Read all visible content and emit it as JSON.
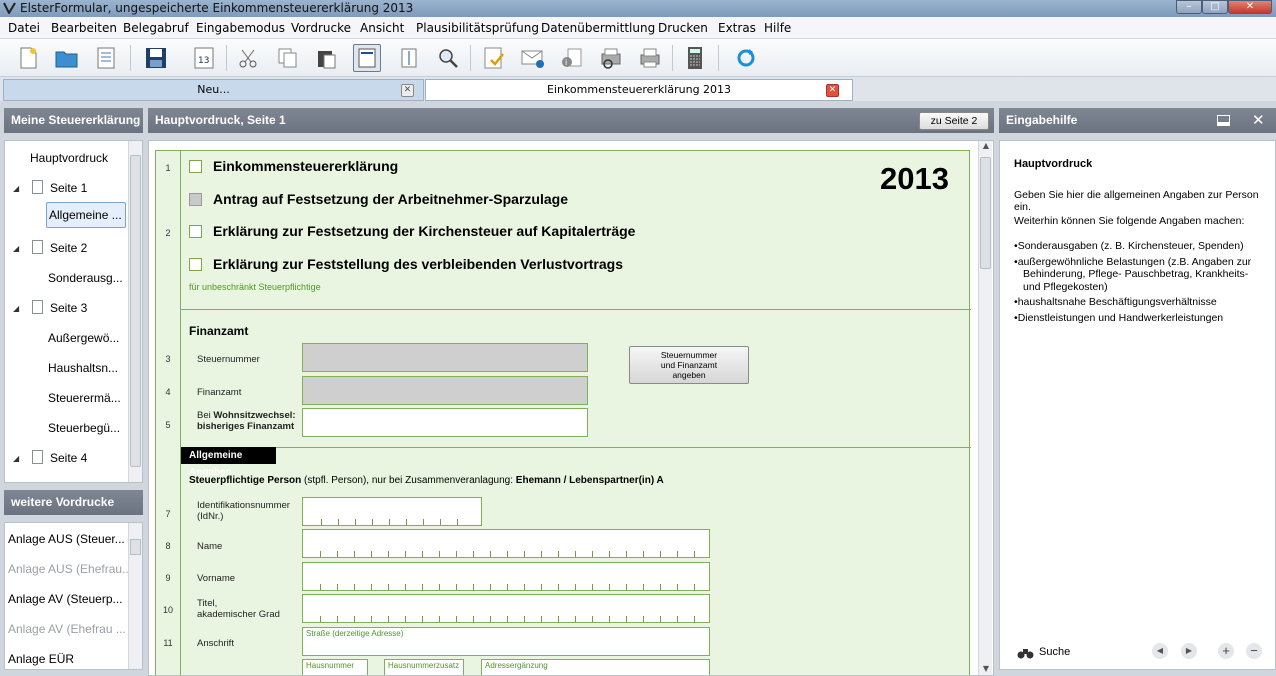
{
  "window": {
    "title": "ElsterFormular, ungespeicherte Einkommensteuererklärung 2013"
  },
  "menu": [
    "Datei",
    "Bearbeiten",
    "Belegabruf",
    "Eingabemodus",
    "Vordrucke",
    "Ansicht",
    "Plausibilitätsprüfung",
    "Datenübermittlung",
    "Drucken",
    "Extras",
    "Hilfe"
  ],
  "tabs": [
    {
      "label": "Neu..."
    },
    {
      "label": "Einkommensteuererklärung 2013"
    }
  ],
  "left": {
    "header": "Meine Steuererklärung",
    "tree": [
      "Hauptvordruck",
      "Seite 1",
      "Allgemeine ...",
      "Seite 2",
      "Sonderausg...",
      "Seite 3",
      "Außergewö...",
      "Haushaltsn...",
      "Steuerermä...",
      "Steuerbegü...",
      "Seite 4"
    ],
    "more_header": "weitere Vordrucke",
    "more": [
      "Anlage AUS (Steuer...",
      "Anlage AUS (Ehefrau...",
      "Anlage AV (Steuerp...",
      "Anlage AV (Ehefrau ...",
      "Anlage EÜR"
    ]
  },
  "center": {
    "header": "Hauptvordruck, Seite 1",
    "goto_button": "zu Seite 2",
    "form": {
      "year": "2013",
      "line_nums": [
        "1",
        "2",
        "3",
        "4",
        "5",
        "7",
        "8",
        "9",
        "10",
        "11"
      ],
      "options": [
        "Einkommensteuererklärung",
        "Antrag auf Festsetzung der Arbeitnehmer-Sparzulage",
        "Erklärung zur Festsetzung der Kirchensteuer auf Kapitalerträge",
        "Erklärung zur Feststellung des verbleibenden Verlustvortrags"
      ],
      "note": "für unbeschränkt Steuerpflichtige",
      "finanzamt_title": "Finanzamt",
      "steuernummer": "Steuernummer",
      "finanzamt": "Finanzamt",
      "wohnsitz_a": "Bei ",
      "wohnsitz_b": "Wohnsitzwechsel:",
      "wohnsitz_c": "bisheriges Finanzamt",
      "sf_button": [
        "Steuernummer",
        "und Finanzamt",
        "angeben"
      ],
      "section": "Allgemeine Angaben",
      "person_a": "Steuerpflichtige Person",
      "person_b": " (stpfl. Person), nur bei Zusammenveranlagung: ",
      "person_c": "Ehemann / Lebenspartner(in) A",
      "idnr_a": "Identifikationsnummer",
      "idnr_b": "(IdNr.)",
      "name": "Name",
      "vorname": "Vorname",
      "titel_a": "Titel,",
      "titel_b": "akademischer Grad",
      "anschrift": "Anschrift",
      "strasse": "Straße (derzeitige Adresse)",
      "hausnummer": "Hausnummer",
      "hausnummerzusatz": "Hausnummerzusatz",
      "adresszusatz": "Adressergänzung"
    }
  },
  "right": {
    "header": "Eingabehilfe",
    "title": "Hauptvordruck",
    "p1": "Geben Sie hier die allgemeinen Angaben zur Person ein.",
    "p2": "Weiterhin können Sie folgende Angaben machen:",
    "bullets": [
      "Sonderausgaben (z. B. Kirchensteuer, Spenden)",
      "außergewöhnliche Belastungen (z.B. Angaben zur Behinderung, Pflege- Pauschbetrag, Krankheits- und Pflegekosten)",
      "haushaltsnahe Beschäftigungsverhältnisse",
      "Dienstleistungen und Handwerkerleistungen"
    ],
    "search": "Suche"
  },
  "colors": {
    "form_bg": "#e9f5e0",
    "form_border": "#7fb15a",
    "panel_head": "#737c88",
    "green_text": "#4c9a2a"
  }
}
